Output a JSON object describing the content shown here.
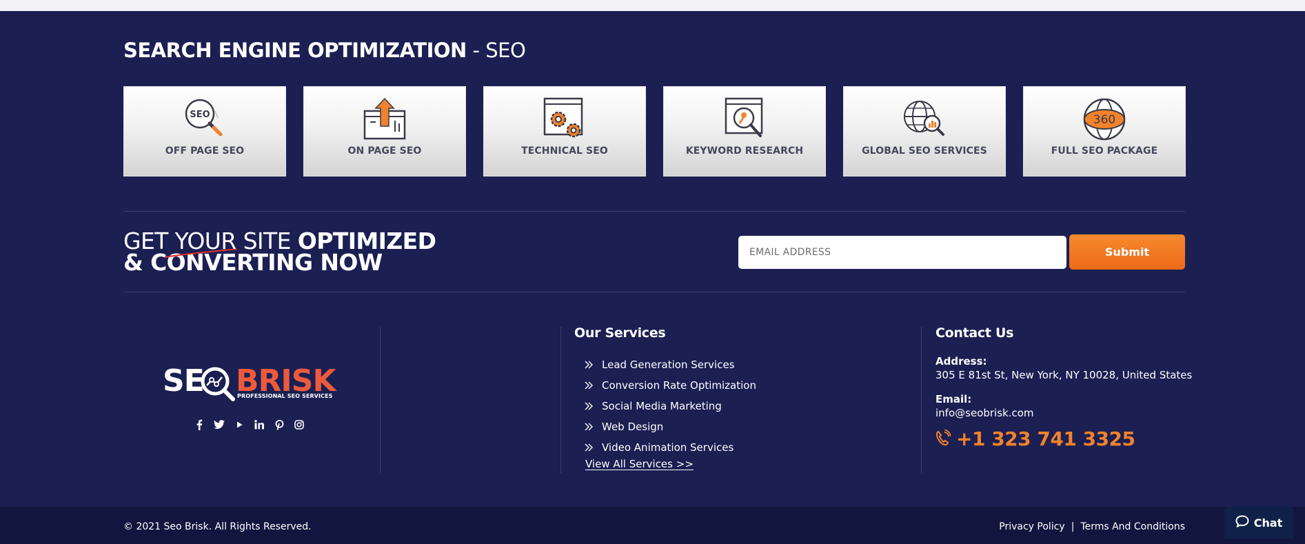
{
  "seo": {
    "title_bold": "SEARCH ENGINE OPTIMIZATION",
    "title_light": " - SEO",
    "cards": [
      {
        "label": "OFF PAGE SEO",
        "icon": "seo-magnifier-icon"
      },
      {
        "label": "ON PAGE SEO",
        "icon": "upload-window-icon"
      },
      {
        "label": "TECHNICAL SEO",
        "icon": "gears-window-icon"
      },
      {
        "label": "KEYWORD RESEARCH",
        "icon": "key-search-icon"
      },
      {
        "label": "GLOBAL SEO SERVICES",
        "icon": "globe-chart-icon"
      },
      {
        "label": "FULL SEO PACKAGE",
        "icon": "globe-360-icon"
      }
    ]
  },
  "cta": {
    "line1_thin": "GET YOUR SITE ",
    "line1_bold": "OPTIMIZED",
    "line2": "& CONVERTING NOW",
    "email_placeholder": "EMAIL ADDRESS",
    "submit_label": "Submit"
  },
  "brand": {
    "logo_left": "SE",
    "logo_right": "BRISK",
    "tagline": "PROFESSIONAL SEO SERVICES",
    "social": [
      "facebook-icon",
      "twitter-icon",
      "youtube-icon",
      "linkedin-icon",
      "pinterest-icon",
      "instagram-icon"
    ]
  },
  "services": {
    "title": "Our Services",
    "items": [
      "Lead Generation Services",
      "Conversion Rate Optimization",
      "Social Media Marketing",
      "Web Design",
      "Video Animation Services"
    ],
    "view_all": "View All Services >>"
  },
  "contact": {
    "title": "Contact Us",
    "address_label": "Address:",
    "address": "305 E 81st St, New York, NY 10028, United States",
    "email_label": "Email:",
    "email": "info@seobrisk.com",
    "phone": "+1 323 741 3325"
  },
  "footer": {
    "copyright": "© 2021 Seo Brisk. All Rights Reserved.",
    "privacy": "Privacy Policy",
    "separator": "|",
    "terms": "Terms And Conditions",
    "chat": "Chat"
  },
  "colors": {
    "background": "#1b1f52",
    "accent_orange": "#f2822b",
    "brand_red": "#ec5a3d",
    "footer_bar": "#12163f"
  }
}
